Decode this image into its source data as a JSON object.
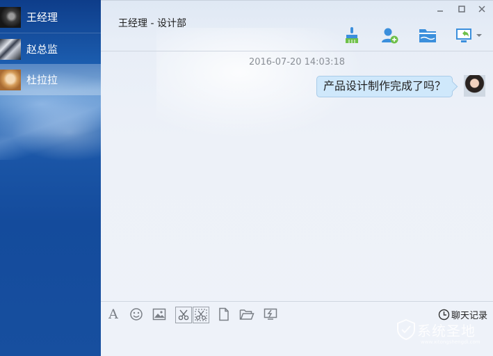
{
  "contacts": [
    {
      "name": "王经理",
      "active": false
    },
    {
      "name": "赵总监",
      "active": false
    },
    {
      "name": "杜拉拉",
      "active": true
    }
  ],
  "chat": {
    "title": "王经理 - 设计部",
    "window_controls": [
      "minimize-icon",
      "maximize-icon",
      "close-icon"
    ],
    "toolbar_icons": [
      "brush-icon",
      "add-contact-icon",
      "folder-icon",
      "screen-share-icon"
    ],
    "messages": [
      {
        "time": "2016-07-20 14:03:18",
        "text": "产品设计制作完成了吗？",
        "sender": "self"
      }
    ]
  },
  "input_toolbar": {
    "icons": [
      "font-icon",
      "emoji-icon",
      "image-icon",
      "scissors-icon",
      "screenshot-options-icon",
      "file-icon",
      "folder-open-icon",
      "shake-icon"
    ],
    "font_glyph": "A",
    "history_label": "聊天记录"
  },
  "watermark": {
    "text": "系统圣地",
    "sub": "www.xitongshengdi.com"
  },
  "colors": {
    "sidebar": "#174f9f",
    "bubble": "#cfe8fb",
    "toolbar_accent": "#2f8fe0"
  }
}
